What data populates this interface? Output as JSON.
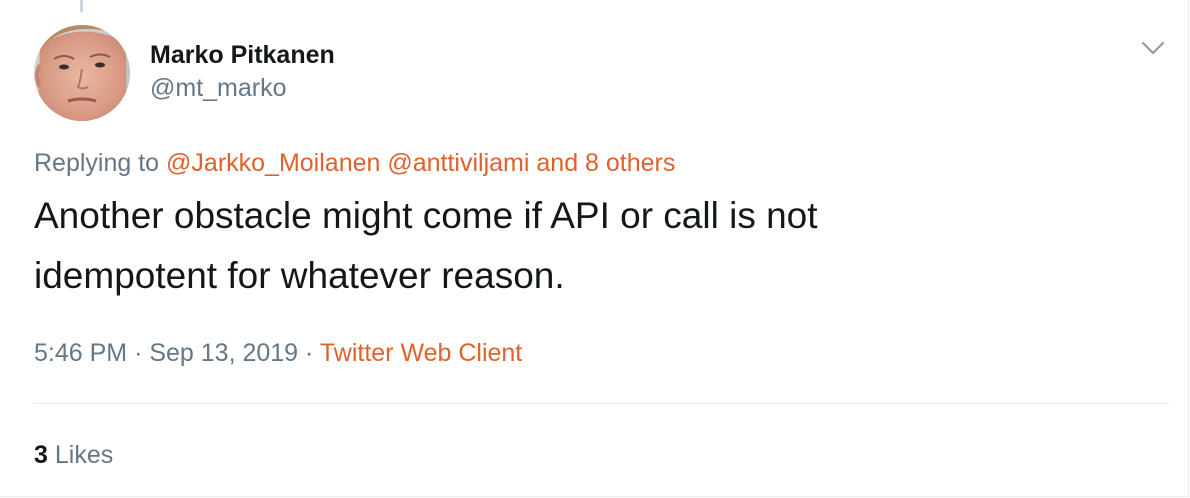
{
  "tweet": {
    "author": {
      "display_name": "Marko Pitkanen",
      "handle": "@mt_marko"
    },
    "replying": {
      "prefix": "Replying to",
      "mentions": [
        "@Jarkko_Moilanen",
        "@anttiviljami"
      ],
      "others": "and 8 others"
    },
    "text_line1": "Another obstacle might come if API or call is not",
    "text_line2": "idempotent for whatever reason.",
    "time": "5:46 PM",
    "separator": "·",
    "date": "Sep 13, 2019",
    "source": "Twitter Web Client",
    "likes": {
      "count": "3",
      "label": "Likes"
    }
  },
  "colors": {
    "accent_link": "#e0612b",
    "secondary_text": "#657786",
    "primary_text": "#14171a",
    "divider": "#e6ecf0"
  },
  "icons": {
    "menu": "chevron-down-icon",
    "avatar": "user-avatar"
  }
}
